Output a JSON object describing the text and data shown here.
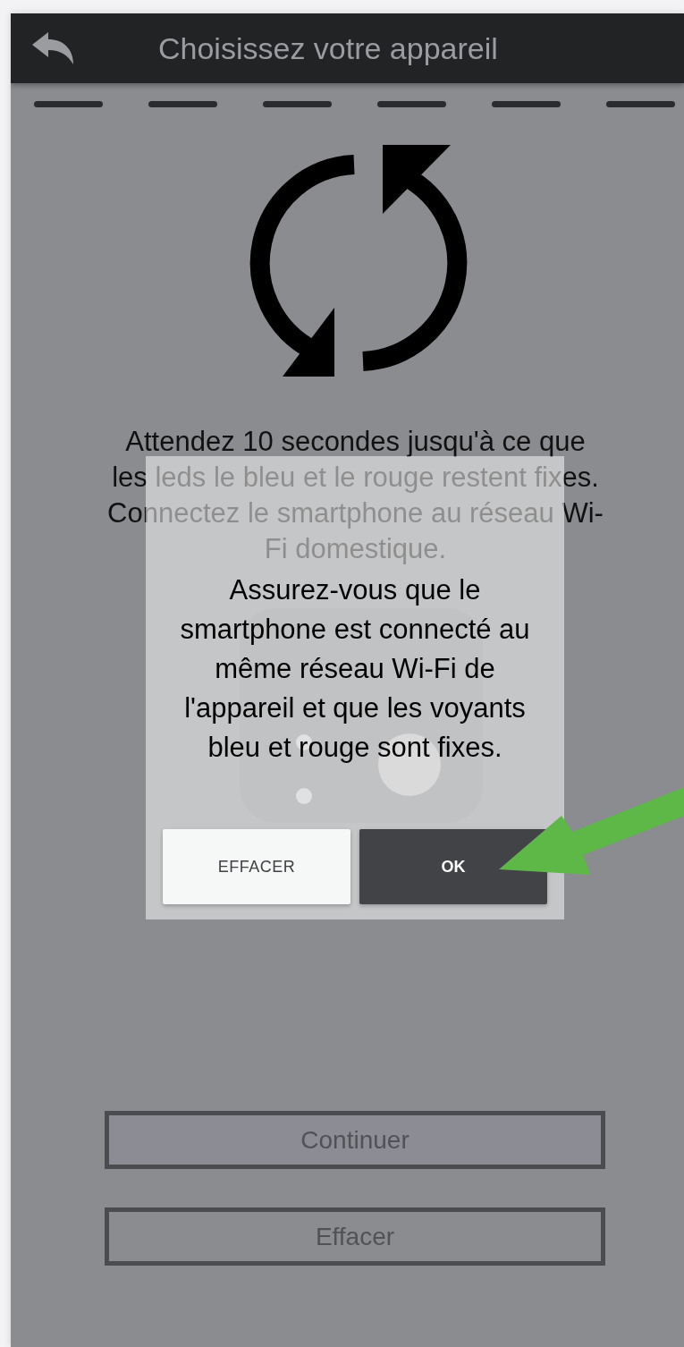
{
  "header": {
    "title": "Choisissez votre appareil"
  },
  "instructions": "Attendez 10 secondes jusqu'à ce que les leds le bleu et le rouge restent fixes. Connectez le smartphone au réseau Wi-Fi domestique.",
  "dialog": {
    "message": "Assurez-vous que le smartphone est connecté au même réseau Wi-Fi de l'appareil et que les voyants bleu et rouge sont fixes.",
    "buttons": [
      {
        "label": "EFFACER",
        "kind": "secondary"
      },
      {
        "label": "OK",
        "kind": "primary"
      }
    ]
  },
  "buttons": [
    {
      "label": "Continuer"
    },
    {
      "label": "Effacer"
    }
  ]
}
